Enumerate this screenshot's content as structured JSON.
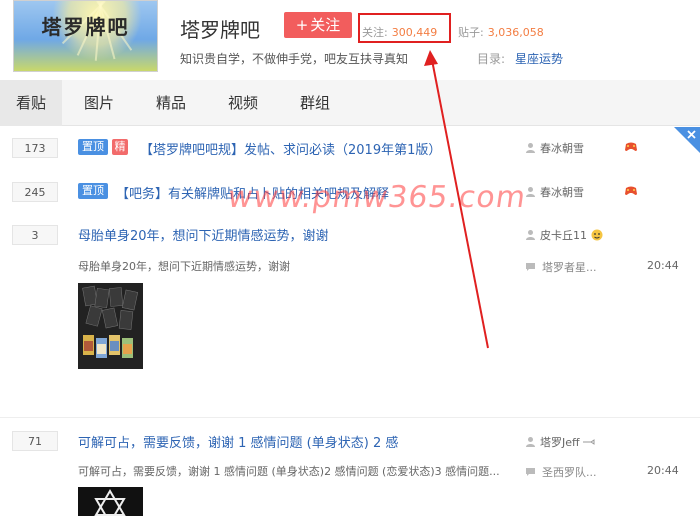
{
  "header": {
    "logo_text": "塔罗牌吧",
    "forum_name": "塔罗牌吧",
    "follow_label": "关注",
    "follow_prefix": "+",
    "followers_label": "关注:",
    "followers_value": "300,449",
    "posts_label": "贴子:",
    "posts_value": "3,036,058",
    "slogan": "知识贵自学，不做伸手党，吧友互扶寻真知",
    "catalog_label": "目录:",
    "catalog_value": "星座运势"
  },
  "tabs": [
    "看贴",
    "图片",
    "精品",
    "视频",
    "群组"
  ],
  "active_tab": "看贴",
  "threads": [
    {
      "replies": "173",
      "badges": [
        "置顶",
        "精"
      ],
      "title": "【塔罗牌吧吧规】发帖、求问必读（2019年第1版）",
      "author": "春冰朝雪"
    },
    {
      "replies": "245",
      "badges": [
        "置顶"
      ],
      "title": "【吧务】有关解牌贴和占卜贴的相关吧规及解释",
      "author": "春冰朝雪"
    },
    {
      "replies": "3",
      "title": "母胎单身20年，想问下近期情感运势，谢谢",
      "abstract": "母胎单身20年，想问下近期情感运势，谢谢",
      "author": "皮卡丘11",
      "last_reply": "塔罗者星...",
      "time": "20:44"
    },
    {
      "replies": "71",
      "title": "可解可占，需要反馈，谢谢 1 感情问题 (单身状态) 2 感",
      "abstract": "可解可占，需要反馈，谢谢 1 感情问题 (单身状态)2 感情问题 (恋爱状态)3 感情问题...",
      "author": "塔罗Jeff",
      "last_reply": "圣西罗队...",
      "time": "20:44"
    }
  ],
  "watermark": "www.pmw365.com",
  "colors": {
    "link": "#2d64b3",
    "follow_button": "#f25d5d",
    "stat_number": "#f37d42",
    "badge_top": "#4a90e2",
    "badge_jing": "#f26b6b",
    "annotation": "#e02020"
  }
}
